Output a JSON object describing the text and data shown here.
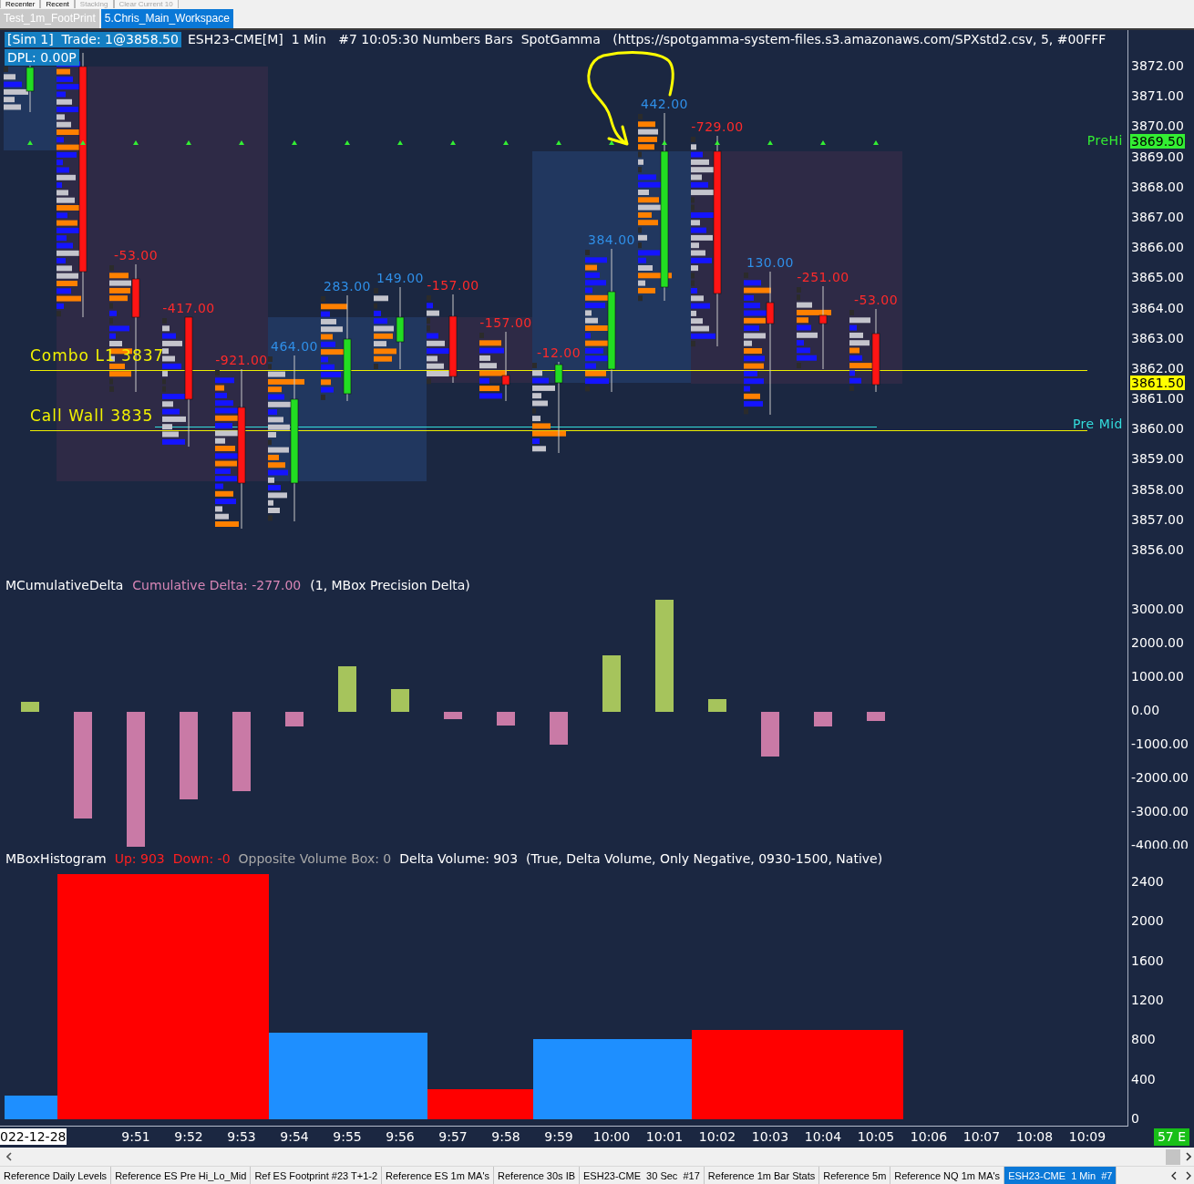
{
  "toolbar": [
    {
      "label": "Recenter",
      "disabled": false
    },
    {
      "label": "Recent",
      "disabled": false
    },
    {
      "label": "Stacking",
      "disabled": true
    },
    {
      "label": "Clear Current 10",
      "disabled": true
    }
  ],
  "workspace_tabs": [
    {
      "label": "Test_1m_FootPrint",
      "selected": false
    },
    {
      "label": "5.Chris_Main_Workspace",
      "selected": true
    }
  ],
  "price_panel": {
    "header": [
      {
        "text": "[Sim 1]  Trade: 1@3858.50",
        "highlighted": true
      },
      {
        "text": "ESH23-CME[M]  1 Min   #7 10:05:30 Numbers Bars  SpotGamma   (https://spotgamma-system-files.s3.amazonaws.com/SPXstd2.csv, 5, #00FFF",
        "highlighted": false
      }
    ],
    "dpl": {
      "text": "DPL: 0.00P",
      "highlighted": true
    },
    "levels": [
      {
        "label": "Combo L1 3837"
      },
      {
        "label": "Call Wall 3835"
      }
    ],
    "reference_lines": [
      {
        "label": "PreHi",
        "color": "#33ee33"
      },
      {
        "label": "Pre Mid",
        "color": "#33dddd"
      }
    ],
    "bar_deltas": [
      {
        "text": "-53.00",
        "color": "#ff2a2a"
      },
      {
        "text": "-417.00",
        "color": "#ff2a2a"
      },
      {
        "text": "-921.00",
        "color": "#ff2a2a"
      },
      {
        "text": "464.00",
        "color": "#2f8fe8"
      },
      {
        "text": "283.00",
        "color": "#2f8fe8"
      },
      {
        "text": "149.00",
        "color": "#2f8fe8"
      },
      {
        "text": "-157.00",
        "color": "#ff2a2a"
      },
      {
        "text": "-157.00",
        "color": "#ff2a2a"
      },
      {
        "text": "-12.00",
        "color": "#ff2a2a"
      },
      {
        "text": "384.00",
        "color": "#2f8fe8"
      },
      {
        "text": "442.00",
        "color": "#2f8fe8"
      },
      {
        "text": "-729.00",
        "color": "#ff2a2a"
      },
      {
        "text": "130.00",
        "color": "#2f8fe8"
      },
      {
        "text": "-251.00",
        "color": "#ff2a2a"
      },
      {
        "text": "-53.00",
        "color": "#ff2a2a"
      }
    ],
    "axis": {
      "ticks": [
        "3872.00",
        "3871.00",
        "3870.00",
        "3869.00",
        "3868.00",
        "3867.00",
        "3866.00",
        "3865.00",
        "3864.00",
        "3863.00",
        "3862.00",
        "3861.00",
        "3860.00",
        "3859.00",
        "3858.00",
        "3857.00",
        "3856.00"
      ],
      "tags": [
        {
          "text": "3869.50",
          "color": "#33ee33"
        },
        {
          "text": "3861.50",
          "color": "#ffff00"
        }
      ]
    }
  },
  "cumulative_delta_panel": {
    "legend": [
      {
        "text": "MCumulativeDelta",
        "color": "#ffffff"
      },
      {
        "text": "Cumulative Delta: -277.00",
        "color": "#d886b6"
      },
      {
        "text": "(1, MBox Precision Delta)",
        "color": "#ffffff"
      }
    ],
    "axis_labels": [
      "3000.00",
      "2000.00",
      "1000.00",
      "0.00",
      "-1000.00",
      "-2000.00",
      "-3000.00",
      "-4000.00"
    ]
  },
  "histogram_panel": {
    "legend": [
      {
        "text": "MBoxHistogram",
        "color": "#ffffff"
      },
      {
        "text": "Up: 903",
        "color": "#ff2020"
      },
      {
        "text": "Down: -0",
        "color": "#ff2020"
      },
      {
        "text": "Opposite Volume Box: 0",
        "color": "#a8a8a8"
      },
      {
        "text": "Delta Volume: 903",
        "color": "#ffffff"
      },
      {
        "text": "(True, Delta Volume, Only Negative, 0930-1500, Native)",
        "color": "#ffffff"
      }
    ],
    "axis_labels": [
      "2400",
      "2000",
      "1600",
      "1200",
      "800",
      "400",
      "0"
    ]
  },
  "time_axis": {
    "date": "022-12-28",
    "ticks": [
      "9:51",
      "9:52",
      "9:53",
      "9:54",
      "9:55",
      "9:56",
      "9:57",
      "9:58",
      "9:59",
      "10:00",
      "10:01",
      "10:02",
      "10:03",
      "10:04",
      "10:05",
      "10:06",
      "10:07",
      "10:08",
      "10:09"
    ],
    "bar_timer": "57 E"
  },
  "sheet_tabs": [
    {
      "label": "Reference Daily Levels",
      "selected": false
    },
    {
      "label": "Reference ES Pre Hi_Lo_Mid",
      "selected": false
    },
    {
      "label": "Ref ES Footprint #23 T+1-2",
      "selected": false
    },
    {
      "label": "Reference ES 1m MA's",
      "selected": false
    },
    {
      "label": "Reference 30s IB",
      "selected": false
    },
    {
      "label": "ESH23-CME  30 Sec  #17",
      "selected": false
    },
    {
      "label": "Reference 1m Bar Stats",
      "selected": false
    },
    {
      "label": "Reference 5m",
      "selected": false
    },
    {
      "label": "Reference NQ 1m MA's",
      "selected": false
    },
    {
      "label": "ESH23-CME  1 Min  #7",
      "selected": true
    }
  ]
}
